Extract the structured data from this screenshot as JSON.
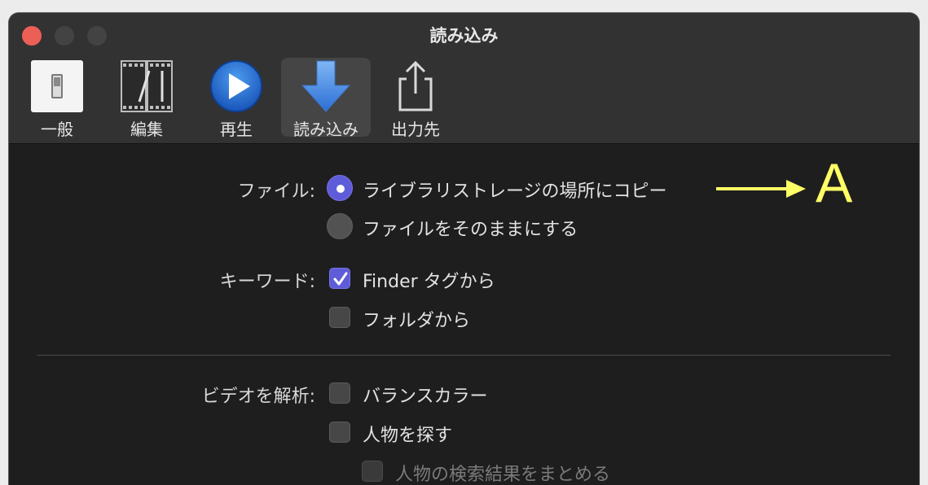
{
  "window": {
    "title": "読み込み"
  },
  "toolbar": {
    "items": [
      {
        "label": "一般",
        "icon": "general-switch-icon"
      },
      {
        "label": "編集",
        "icon": "film-edit-icon"
      },
      {
        "label": "再生",
        "icon": "play-icon"
      },
      {
        "label": "読み込み",
        "icon": "download-arrow-icon",
        "selected": true
      },
      {
        "label": "出力先",
        "icon": "share-icon"
      }
    ]
  },
  "settings": {
    "files": {
      "label": "ファイル:",
      "options": [
        {
          "label": "ライブラリストレージの場所にコピー",
          "selected": true
        },
        {
          "label": "ファイルをそのままにする",
          "selected": false
        }
      ]
    },
    "keywords": {
      "label": "キーワード:",
      "options": [
        {
          "label": "Finder タグから",
          "checked": true
        },
        {
          "label": "フォルダから",
          "checked": false
        }
      ]
    },
    "analyze_video": {
      "label": "ビデオを解析:",
      "options": [
        {
          "label": "バランスカラー",
          "checked": false
        },
        {
          "label": "人物を探す",
          "checked": false
        },
        {
          "label": "人物の検索結果をまとめる",
          "checked": false,
          "disabled": true
        }
      ]
    }
  },
  "annotation": {
    "letter": "A",
    "color": "#ffff66"
  },
  "colors": {
    "accent": "#5e5cd8",
    "close_button": "#ec5f57"
  }
}
